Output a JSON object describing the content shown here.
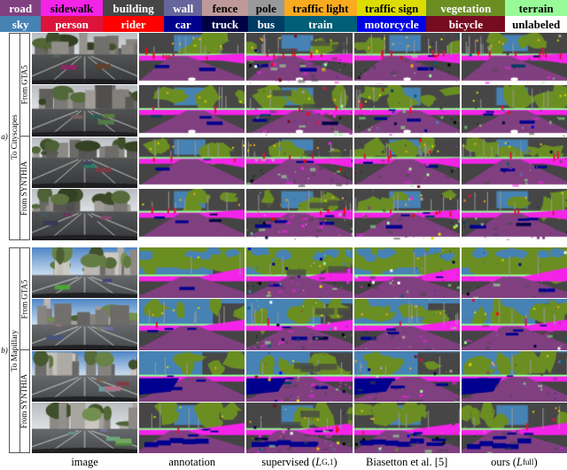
{
  "legend": {
    "row1": [
      {
        "label": "road",
        "color": "#804080",
        "text_color": "#ffffff",
        "flex": 52
      },
      {
        "label": "sidewalk",
        "color": "#f423e8",
        "text_color": "#000000",
        "flex": 78
      },
      {
        "label": "building",
        "color": "#464646",
        "text_color": "#ffffff",
        "flex": 78
      },
      {
        "label": "wall",
        "color": "#66669c",
        "text_color": "#ffffff",
        "flex": 48
      },
      {
        "label": "fence",
        "color": "#be9999",
        "text_color": "#000000",
        "flex": 58
      },
      {
        "label": "pole",
        "color": "#999999",
        "text_color": "#000000",
        "flex": 46
      },
      {
        "label": "traffic light",
        "color": "#faaa1e",
        "text_color": "#000000",
        "flex": 92
      },
      {
        "label": "traffic sign",
        "color": "#dcdc00",
        "text_color": "#000000",
        "flex": 88
      },
      {
        "label": "vegetation",
        "color": "#6b8e23",
        "text_color": "#ffffff",
        "flex": 100
      },
      {
        "label": "terrain",
        "color": "#98fb98",
        "text_color": "#000000",
        "flex": 78
      }
    ],
    "row2": [
      {
        "label": "sky",
        "color": "#4682b4",
        "text_color": "#ffffff",
        "flex": 52
      },
      {
        "label": "person",
        "color": "#dc143c",
        "text_color": "#ffffff",
        "flex": 78
      },
      {
        "label": "rider",
        "color": "#ff0000",
        "text_color": "#ffffff",
        "flex": 78
      },
      {
        "label": "car",
        "color": "#00008e",
        "text_color": "#ffffff",
        "flex": 48
      },
      {
        "label": "truck",
        "color": "#000046",
        "text_color": "#ffffff",
        "flex": 58
      },
      {
        "label": "bus",
        "color": "#003c64",
        "text_color": "#ffffff",
        "flex": 46
      },
      {
        "label": "train",
        "color": "#005f77",
        "text_color": "#ffffff",
        "flex": 92
      },
      {
        "label": "motorcycle",
        "color": "#0000e6",
        "text_color": "#ffffff",
        "flex": 88
      },
      {
        "label": "bicycle",
        "color": "#770b20",
        "text_color": "#ffffff",
        "flex": 100
      },
      {
        "label": "unlabeled",
        "color": "#ffffff",
        "text_color": "#000000",
        "flex": 78
      }
    ]
  },
  "columns": [
    {
      "id": "image",
      "label": "image",
      "math": ""
    },
    {
      "id": "annotation",
      "label": "annotation",
      "math": ""
    },
    {
      "id": "supervised",
      "label": "supervised (",
      "math": "L",
      "sub": "G,1",
      "tail": ")"
    },
    {
      "id": "biasetton",
      "label": "Biasetton et al. [5]",
      "math": ""
    },
    {
      "id": "ours",
      "label": "ours (",
      "math": "L",
      "sub": "full",
      "tail": ")"
    }
  ],
  "sections": [
    {
      "tag": "a)",
      "target": "To Cityscapes",
      "sources": [
        "From GTA5",
        "From SYNTHIA"
      ],
      "rows": [
        {
          "source": "From GTA5",
          "scene": "cs_gta_1"
        },
        {
          "source": "From GTA5",
          "scene": "cs_gta_2"
        },
        {
          "source": "From SYNTHIA",
          "scene": "cs_syn_1"
        },
        {
          "source": "From SYNTHIA",
          "scene": "cs_syn_2"
        }
      ]
    },
    {
      "tag": "b)",
      "target": "To Mapillary",
      "sources": [
        "From GTA5",
        "From SYNTHIA"
      ],
      "rows": [
        {
          "source": "From GTA5",
          "scene": "mp_gta_1"
        },
        {
          "source": "From GTA5",
          "scene": "mp_gta_2"
        },
        {
          "source": "From SYNTHIA",
          "scene": "mp_syn_1"
        },
        {
          "source": "From SYNTHIA",
          "scene": "mp_syn_2"
        }
      ]
    }
  ],
  "palette": {
    "road": "#804080",
    "sidewalk": "#f423e8",
    "building": "#464646",
    "wall": "#66669c",
    "fence": "#be9999",
    "pole": "#999999",
    "traffic_light": "#faaa1e",
    "traffic_sign": "#dcdc00",
    "vegetation": "#6b8e23",
    "terrain": "#98fb98",
    "sky": "#4682b4",
    "person": "#dc143c",
    "rider": "#ff0000",
    "car": "#00008e",
    "truck": "#000046",
    "bus": "#003c64",
    "train": "#005f77",
    "motorcycle": "#0000e6",
    "bicycle": "#770b20",
    "unlabeled": "#ffffff"
  }
}
